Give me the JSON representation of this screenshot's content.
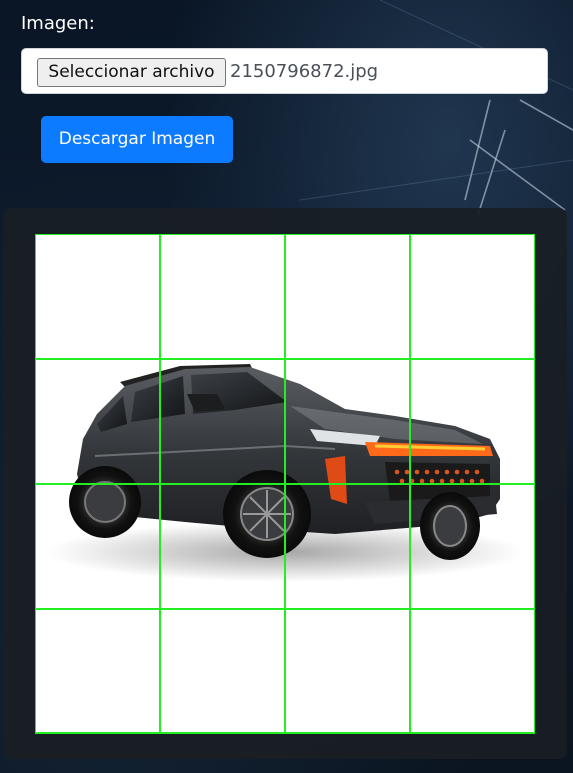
{
  "form": {
    "label": "Imagen:",
    "file_button_label": "Seleccionar archivo",
    "file_name": "2150796872.jpg",
    "download_label": "Descargar Imagen"
  },
  "canvas": {
    "grid_rows": 4,
    "grid_cols": 4,
    "grid_color": "#22ee22",
    "image_subject": "black-suv-car-image"
  },
  "colors": {
    "primary_button": "#0d7bff",
    "panel_bg": "#1a1f24",
    "page_bg": "#0d1b2c"
  }
}
